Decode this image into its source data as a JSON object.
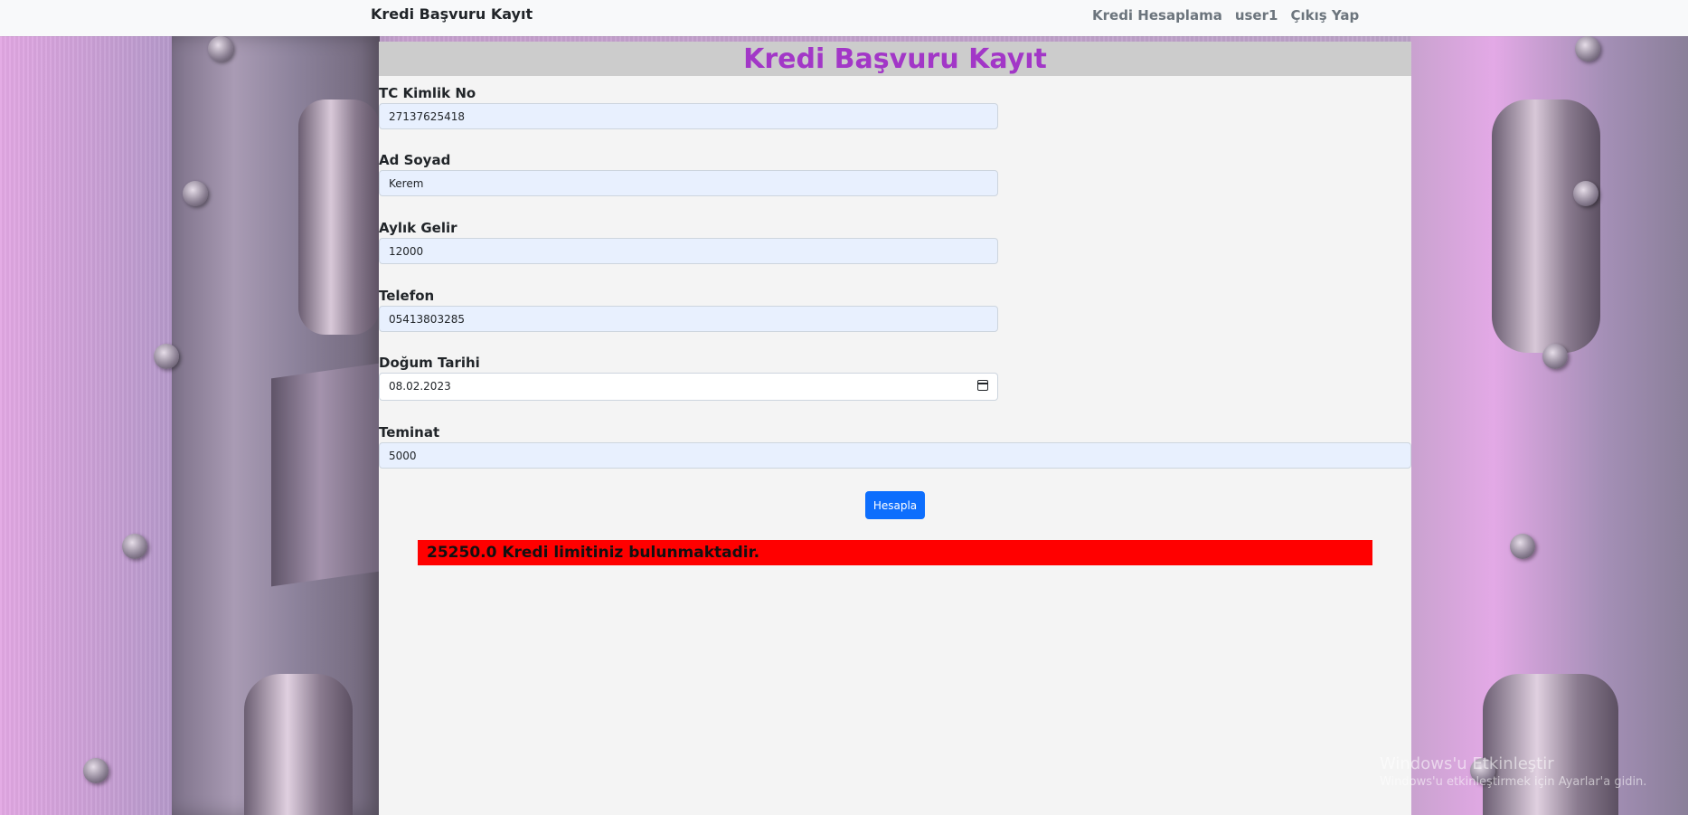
{
  "navbar": {
    "brand": "Kredi Başvuru Kayıt",
    "links": [
      "Kredi Hesaplama",
      "user1",
      "Çıkış Yap"
    ]
  },
  "form": {
    "title": "Kredi Başvuru Kayıt",
    "fields": {
      "tc": {
        "label": "TC Kimlik No",
        "value": "27137625418"
      },
      "name": {
        "label": "Ad Soyad",
        "value": "Kerem"
      },
      "income": {
        "label": "Aylık Gelir",
        "value": "12000"
      },
      "phone": {
        "label": "Telefon",
        "value": "05413803285"
      },
      "birth": {
        "label": "Doğum Tarihi",
        "value": "08.02.2023"
      },
      "collateral": {
        "label": "Teminat",
        "value": "5000"
      }
    },
    "submit_label": "Hesapla",
    "result": "25250.0 Kredi limitiniz bulunmaktadir."
  },
  "watermark": {
    "line1": "Windows'u Etkinleştir",
    "line2": "Windows'u etkinleştirmek için Ayarlar'a gidin."
  },
  "colors": {
    "title": "#a237c7",
    "button": "#0d6efd",
    "result_bg": "#ff0000"
  }
}
